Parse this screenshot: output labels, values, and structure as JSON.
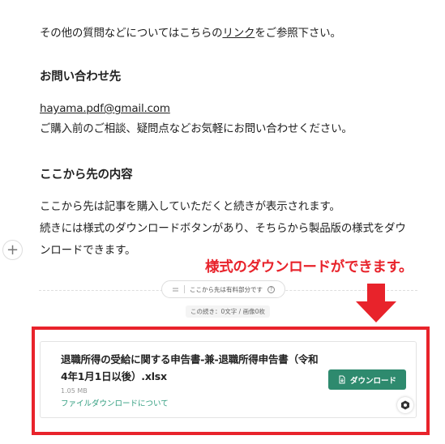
{
  "intro": {
    "before": "その他の質問などについてはこちらの",
    "link": "リンク",
    "after": "をご参照下さい。"
  },
  "contact": {
    "heading": "お問い合わせ先",
    "email": "hayama.pdf@gmail.com",
    "note": "ご購入前のご相談、疑問点などお気軽にお問い合わせください。"
  },
  "paid": {
    "heading": "ここから先の内容",
    "line1": "ここから先は記事を購入していただくと続きが表示されます。",
    "line2": "続きには様式のダウンロードボタンがあり、そちらから製品版の様式をダウ",
    "line3": "ンロードできます。"
  },
  "annotation": "様式のダウンロードができます。",
  "paywall": {
    "divider_label": "ここから先は有料部分です",
    "count_label": "この続き：0文字 / 画像0枚"
  },
  "file": {
    "title": "退職所得の受給に関する申告書-兼-退職所得申告書（令和4年1月1日以後）.xlsx",
    "size": "1.05 MB",
    "help": "ファイルダウンロードについて",
    "download_label": "ダウンロード"
  },
  "icons": [
    "plus-icon",
    "equal-icon",
    "question-icon",
    "down-arrow-icon",
    "download-icon",
    "logo-icon"
  ],
  "colors": {
    "accent_green": "#2e8a6e",
    "annotation_red": "#e8232b"
  }
}
